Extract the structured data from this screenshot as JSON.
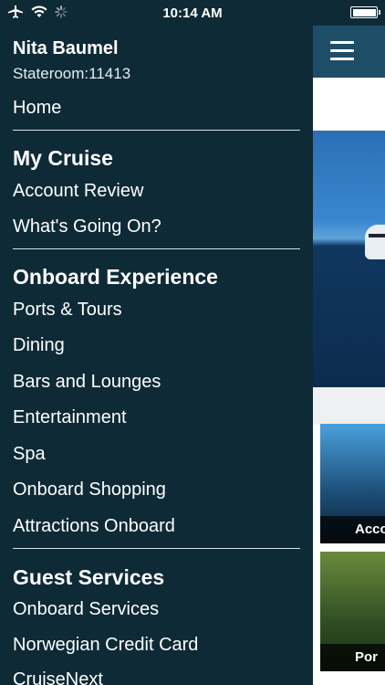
{
  "status_bar": {
    "time": "10:14 AM"
  },
  "user": {
    "name": "Nita Baumel",
    "stateroom_label": "Stateroom:",
    "stateroom_number": "11413"
  },
  "menu": {
    "home": "Home",
    "sections": [
      {
        "heading": "My Cruise",
        "items": [
          "Account Review",
          "What's Going On?"
        ]
      },
      {
        "heading": "Onboard Experience",
        "items": [
          "Ports & Tours",
          "Dining",
          "Bars and Lounges",
          "Entertainment",
          "Spa",
          "Onboard Shopping",
          "Attractions Onboard"
        ]
      },
      {
        "heading": "Guest Services",
        "items": [
          "Onboard Services",
          "Norwegian Credit Card",
          "CruiseNext"
        ]
      }
    ]
  },
  "content": {
    "cards": [
      "Acco",
      "Por"
    ]
  },
  "colors": {
    "menu_bg": "#0e2a36",
    "topbar": "#1e4d68"
  }
}
